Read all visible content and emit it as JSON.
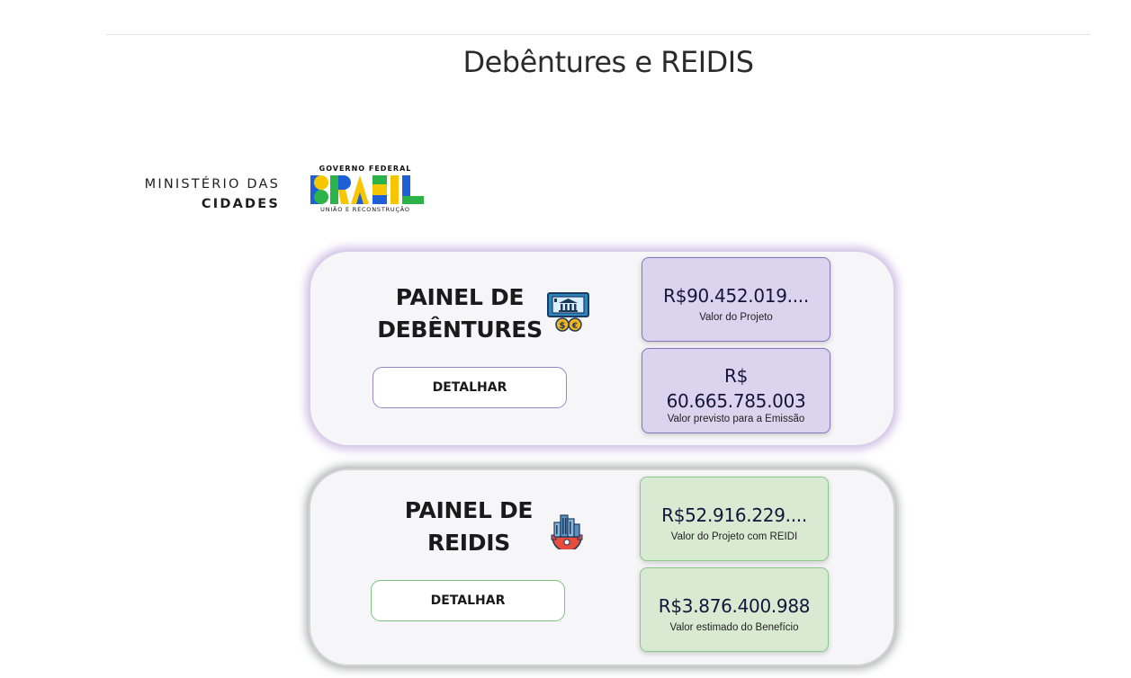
{
  "page": {
    "title": "Debêntures e REIDIS"
  },
  "logos": {
    "ministry_line1": "MINISTÉRIO DAS",
    "ministry_line2": "CIDADES",
    "gov_top": "GOVERNO FEDERAL",
    "gov_word": "BRASIL",
    "gov_bottom": "UNIÃO E RECONSTRUÇÃO"
  },
  "panels": {
    "debentures": {
      "title_line1": "PAINEL DE",
      "title_line2": "DEBÊNTURES",
      "button": "DETALHAR",
      "icon": "bank-money-icon",
      "card1": {
        "value": "R$90.452.019....",
        "label": "Valor do Projeto"
      },
      "card2": {
        "value_line1": "R$",
        "value_line2": "60.665.785.003",
        "label": "Valor previsto para a Emissão"
      }
    },
    "reidis": {
      "title_line1": "PAINEL DE",
      "title_line2": "REIDIS",
      "button": "DETALHAR",
      "icon": "city-gear-icon",
      "card1": {
        "value": "R$52.916.229....",
        "label": "Valor do Projeto com REIDI"
      },
      "card2": {
        "value": "R$3.876.400.988",
        "label": "Valor estimado do Benefício"
      }
    }
  },
  "colors": {
    "purple_card": "#dcd3ee",
    "purple_border": "#8672bd",
    "green_card": "#d9ead3",
    "green_border": "#8cc68a"
  }
}
